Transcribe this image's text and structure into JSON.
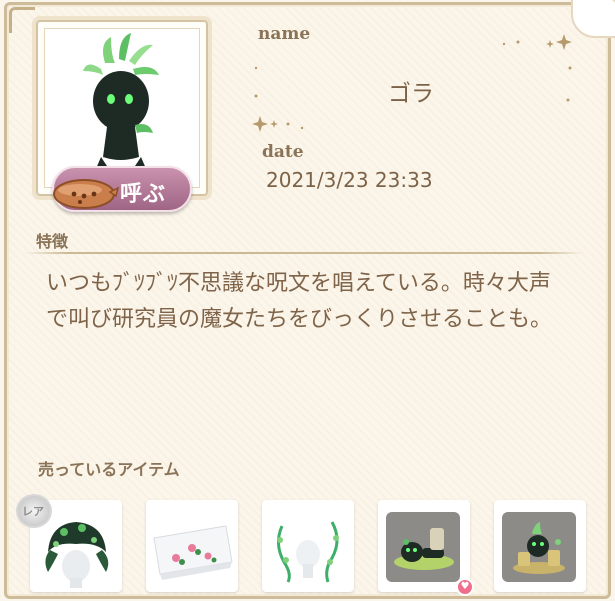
{
  "profile": {
    "name_label": "name",
    "name": "ゴラ",
    "date_label": "date",
    "date": "2021/3/23 23:33",
    "call_button": "呼ぶ"
  },
  "traits": {
    "heading": "特徴",
    "description": "いつもﾌﾞﾂﾌﾞﾂ不思議な呪文を唱えている。時々大声で叫び研究員の魔女たちをびっくりさせることも。"
  },
  "shop": {
    "heading": "売っているアイテム",
    "rare_badge": "レア",
    "items": [
      {
        "icon": "green-leaf-hair-icon",
        "rare": true
      },
      {
        "icon": "flower-cloth-icon"
      },
      {
        "icon": "vine-accessory-icon"
      },
      {
        "icon": "lying-creature-figure-icon",
        "new": true
      },
      {
        "icon": "creature-pile-figure-icon"
      }
    ]
  },
  "colors": {
    "accent_pink": "#a06585",
    "text_brown": "#7f6449",
    "frame": "#cdbb9a"
  }
}
